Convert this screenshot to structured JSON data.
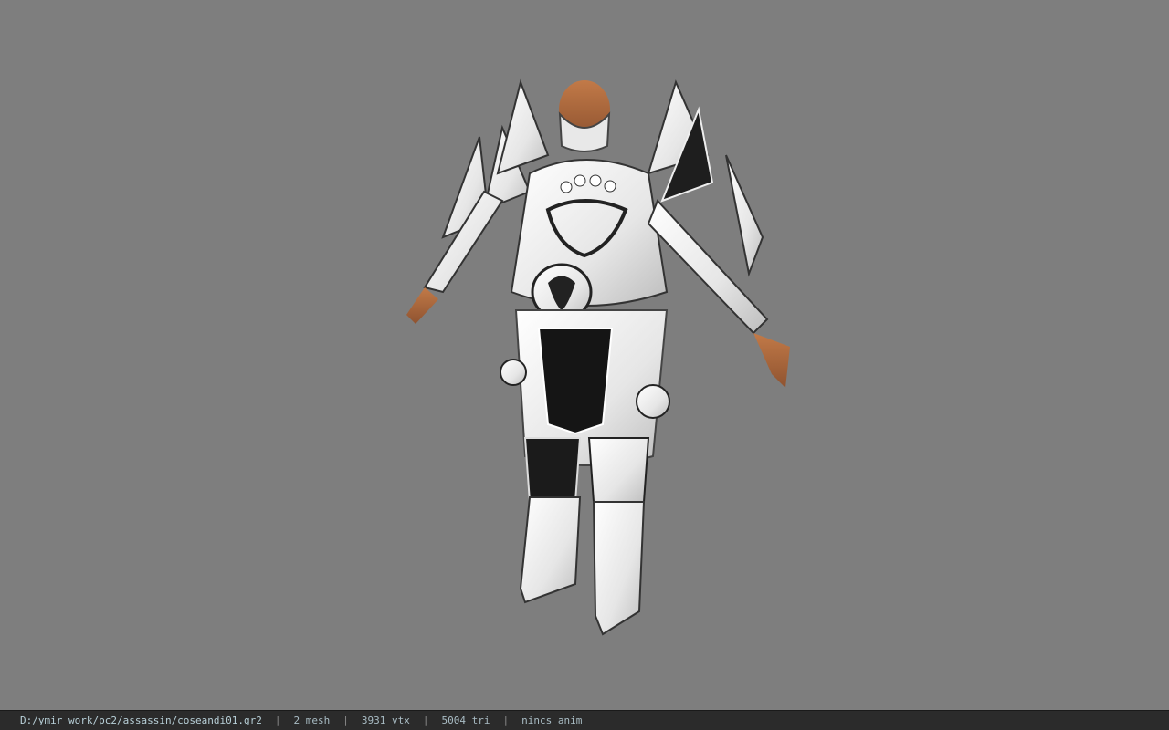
{
  "viewport": {
    "background_color": "#7e7e7e",
    "model": {
      "icon": "character-model",
      "armor_color": "#f2f2f2",
      "skin_color": "#b06a3c"
    }
  },
  "statusbar": {
    "file_path": "D:/ymir work/pc2/assassin/coseandi01.gr2",
    "separator": "|",
    "mesh_count": "2 mesh",
    "vertex_count": "3931 vtx",
    "triangle_count": "5004 tri",
    "anim_status": "nincs anim",
    "background_color": "#2b2b2b",
    "text_color": "#a9bcc4"
  }
}
